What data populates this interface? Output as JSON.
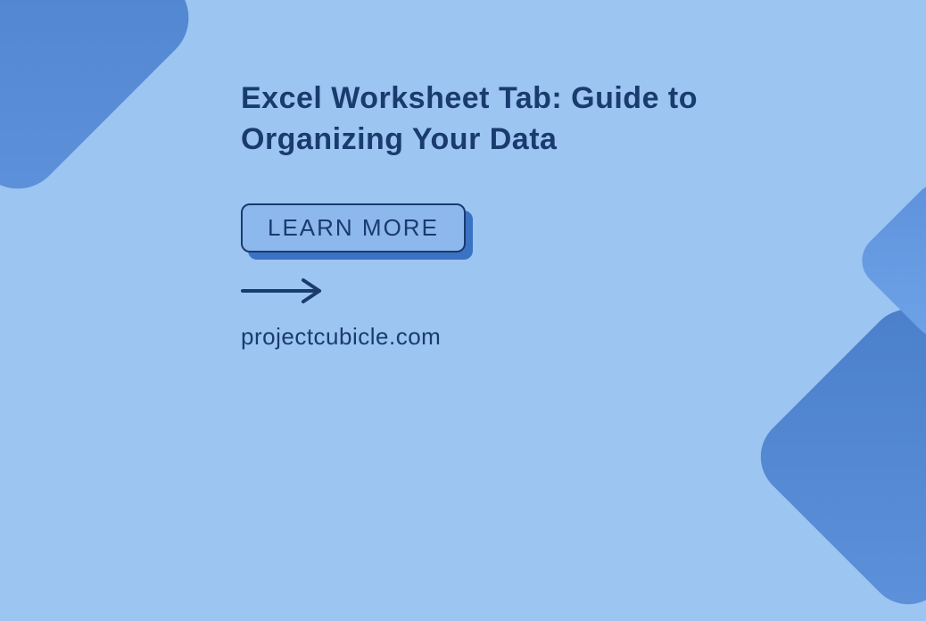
{
  "title": "Excel Worksheet Tab: Guide to Organizing Your Data",
  "button_label": "LEARN MORE",
  "site_name": "projectcubicle.com",
  "colors": {
    "background": "#9cc5f2",
    "text_dark": "#1a3b6e",
    "accent": "#4a7fc9"
  }
}
